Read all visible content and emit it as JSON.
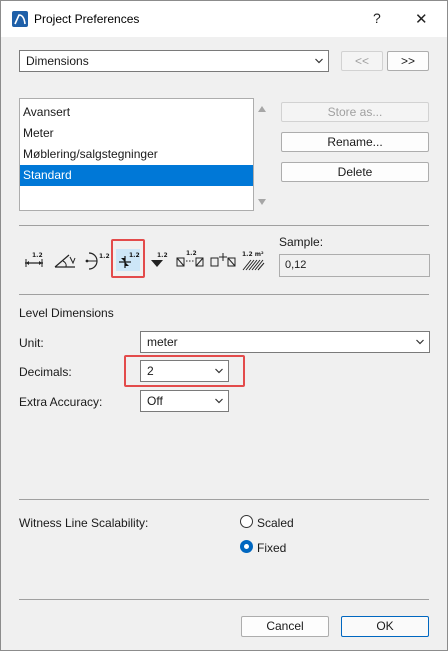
{
  "window": {
    "title": "Project Preferences",
    "help_glyph": "?",
    "close_glyph": "✕"
  },
  "preferences_page": {
    "selected": "Dimensions",
    "prev_label": "<<",
    "next_label": ">>"
  },
  "schemes": {
    "items": [
      "Avansert",
      "Meter",
      "Møblering/salgstegninger",
      "Standard"
    ],
    "selected_index": 3
  },
  "scheme_buttons": {
    "store_as": "Store as...",
    "rename": "Rename...",
    "delete": "Delete"
  },
  "dimension_types": {
    "icons": [
      {
        "name": "linear-dimension-icon",
        "label": "1.2"
      },
      {
        "name": "angle-dimension-icon",
        "label": ""
      },
      {
        "name": "radial-dimension-icon",
        "label": "1.2"
      },
      {
        "name": "level-dimension-icon",
        "label": "1.2",
        "selected": true
      },
      {
        "name": "elevation-dimension-icon",
        "label": "1.2"
      },
      {
        "name": "door-window-dimension-icon",
        "label": "1.2"
      },
      {
        "name": "sill-height-dimension-icon",
        "label": ""
      },
      {
        "name": "area-dimension-icon",
        "label": "1.2 m²"
      }
    ]
  },
  "sample": {
    "label": "Sample:",
    "value": "0,12"
  },
  "level_dimensions": {
    "heading": "Level Dimensions",
    "unit_label": "Unit:",
    "unit_value": "meter",
    "decimals_label": "Decimals:",
    "decimals_value": "2",
    "extra_accuracy_label": "Extra Accuracy:",
    "extra_accuracy_value": "Off"
  },
  "witness": {
    "label": "Witness Line Scalability:",
    "options": [
      {
        "label": "Scaled",
        "checked": false
      },
      {
        "label": "Fixed",
        "checked": true
      }
    ]
  },
  "footer": {
    "cancel": "Cancel",
    "ok": "OK"
  },
  "colors": {
    "selection": "#0078d7",
    "highlight": "#e34b4b",
    "accent": "#0067c0"
  }
}
